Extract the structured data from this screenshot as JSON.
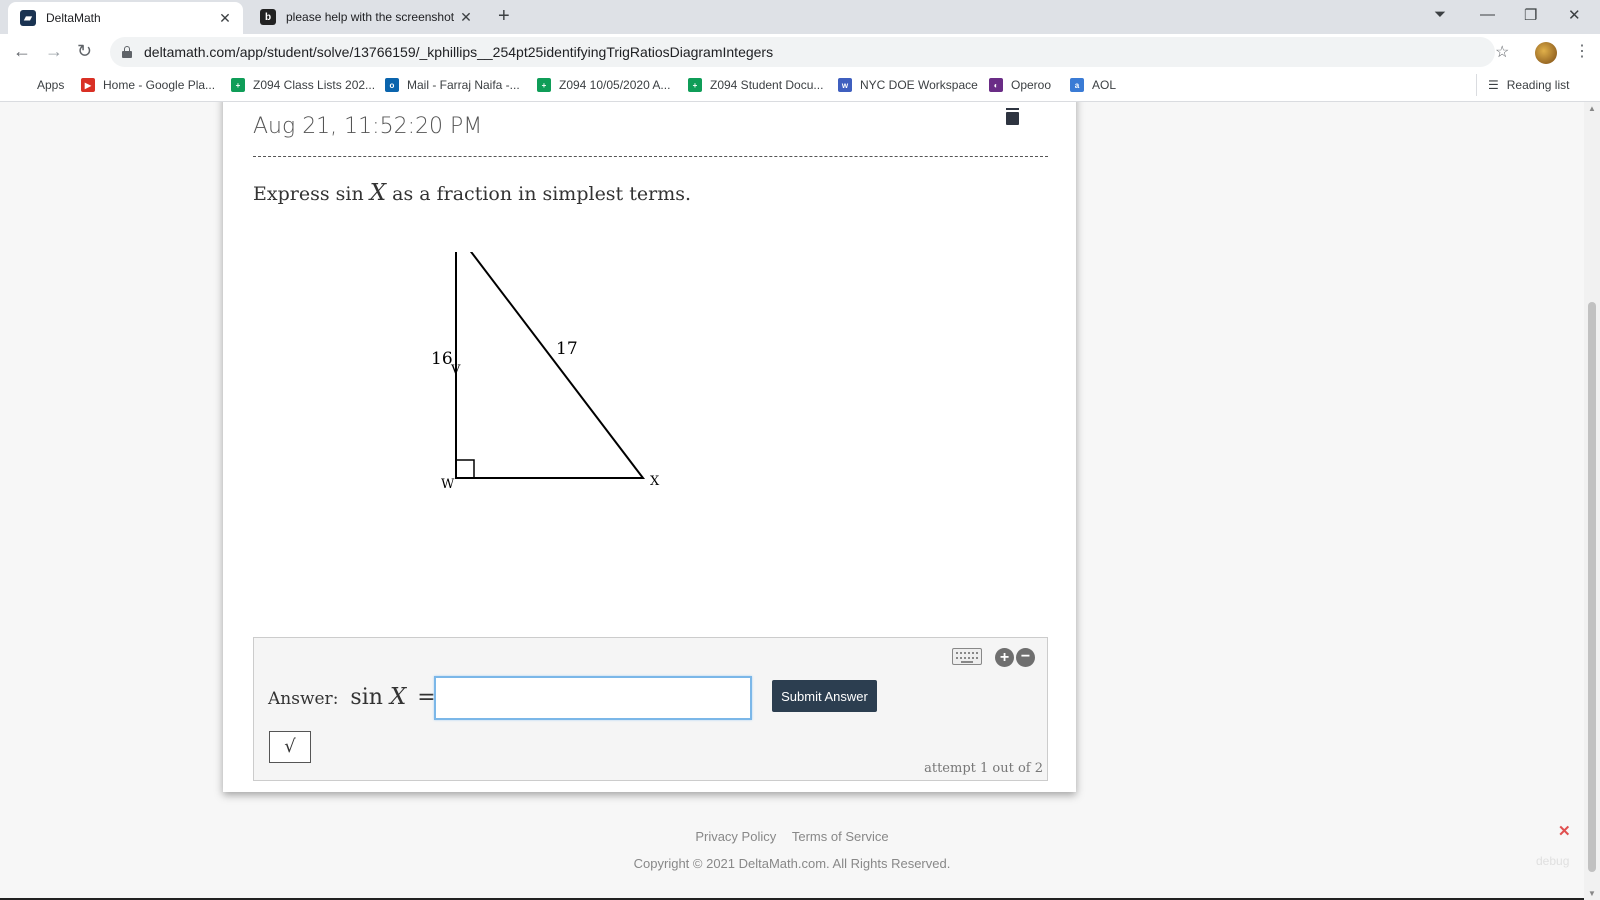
{
  "browser": {
    "tabs": [
      {
        "title": "DeltaMath",
        "favicon": "deltamath-icon"
      },
      {
        "title": "please help with the screenshot",
        "favicon": "brainly-icon"
      }
    ],
    "url": "deltamath.com/app/student/solve/13766159/_kphillips__254pt25identifyingTrigRatiosDiagramIntegers",
    "bookmarks": [
      {
        "label": "Apps",
        "icon": "apps-grid-icon"
      },
      {
        "label": "Home - Google Pla...",
        "icon": "google-play-icon"
      },
      {
        "label": "Z094 Class Lists 202...",
        "icon": "sheets-icon"
      },
      {
        "label": "Mail - Farraj Naifa -...",
        "icon": "outlook-icon"
      },
      {
        "label": "Z094 10/05/2020 A...",
        "icon": "sheets-icon"
      },
      {
        "label": "Z094 Student Docu...",
        "icon": "sheets-icon"
      },
      {
        "label": "NYC DOE Workspace",
        "icon": "nyc-doe-icon"
      },
      {
        "label": "Operoo",
        "icon": "operoo-icon"
      },
      {
        "label": "AOL",
        "icon": "aol-icon"
      }
    ],
    "reading_list": "Reading list"
  },
  "problem": {
    "timestamp": "Aug 21, 11:52:20 PM",
    "prompt_before": "Express sin ",
    "prompt_var": "X",
    "prompt_after": " as a fraction in simplest terms.",
    "diagram": {
      "vertices": {
        "top": "V",
        "right_angle": "W",
        "right": "X"
      },
      "side_labels": {
        "vw": "16",
        "vx": "17"
      }
    }
  },
  "answer": {
    "label": "Answer:",
    "expr_fn": "sin",
    "expr_var": "X",
    "equals": "=",
    "input_value": "",
    "submit_label": "Submit Answer",
    "sqrt_label": "√",
    "attempt_text": "attempt 1 out of 2"
  },
  "footer": {
    "privacy": "Privacy Policy",
    "terms": "Terms of Service",
    "copyright": "Copyright © 2021 DeltaMath.com. All Rights Reserved.",
    "debug": "debug"
  }
}
